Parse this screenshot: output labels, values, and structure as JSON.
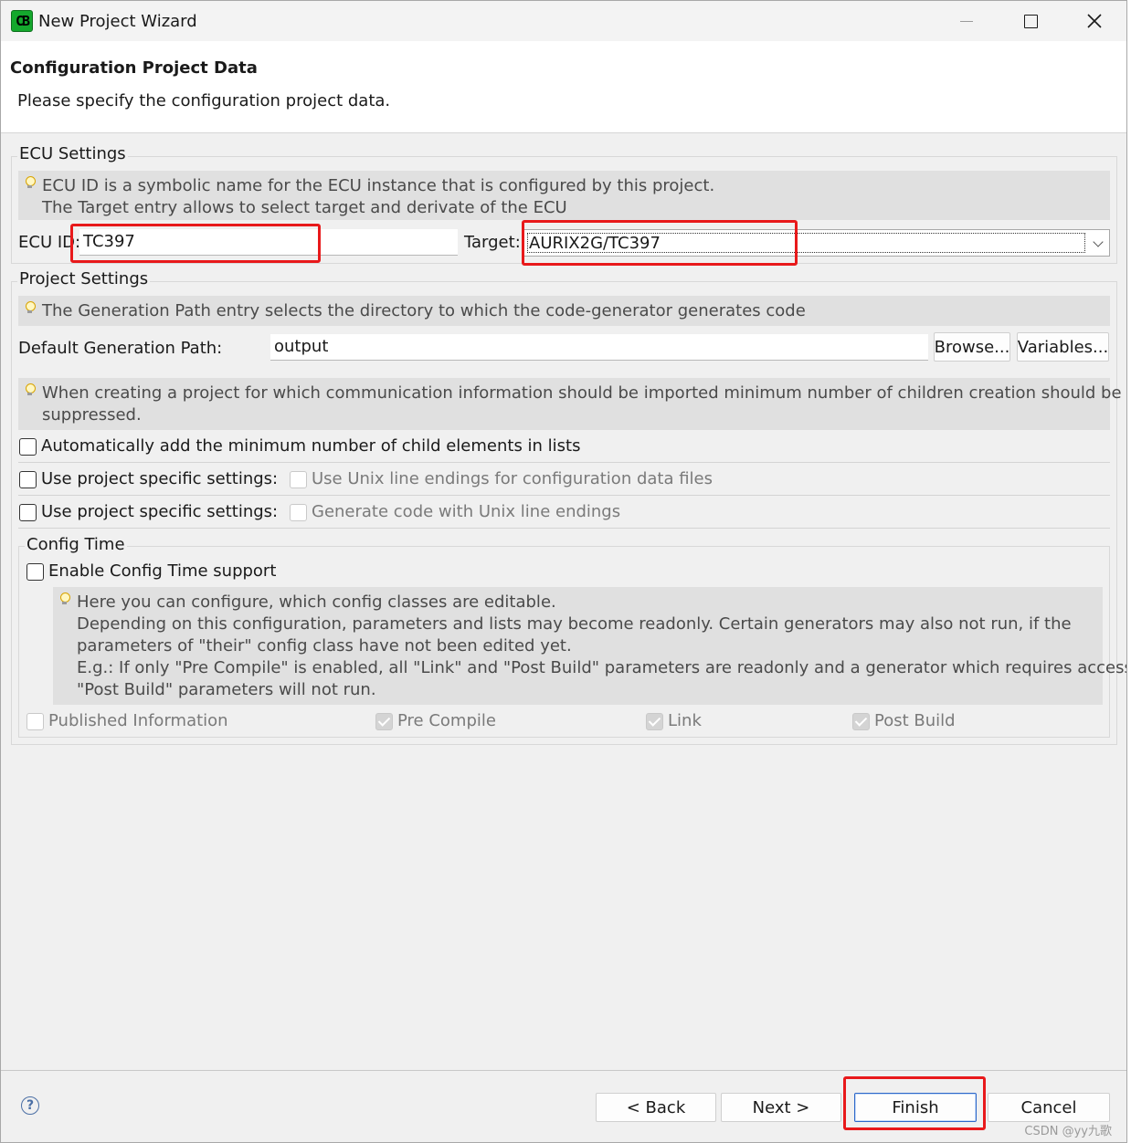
{
  "window": {
    "title": "New Project Wizard",
    "app_icon_text": "CB"
  },
  "header": {
    "title": "Configuration Project Data",
    "description": "Please specify the configuration project data."
  },
  "ecu_settings": {
    "group_label": "ECU Settings",
    "info_line1": "ECU ID is a symbolic name for the ECU instance that is configured by this project.",
    "info_line2": "The Target entry allows to select target and derivate of the ECU",
    "ecu_id_label": "ECU ID:",
    "ecu_id_value": "TC397",
    "target_label": "Target:",
    "target_value": "AURIX2G/TC397"
  },
  "project_settings": {
    "group_label": "Project Settings",
    "info": "The Generation Path entry selects the directory to which the code-generator generates code",
    "path_label": "Default Generation Path:",
    "path_value": "output",
    "browse_label": "Browse...",
    "variables_label": "Variables...",
    "info2_line1": "When creating a project for which communication information should be imported minimum number of children creation should be",
    "info2_line2": "suppressed.",
    "auto_add_label": "Automatically add the minimum number of child elements in lists",
    "specific1_label": "Use project specific settings:",
    "unix_config_label": "Use Unix line endings for configuration data files",
    "specific2_label": "Use project specific settings:",
    "unix_code_label": "Generate code with Unix line endings"
  },
  "config_time": {
    "group_label": "Config Time",
    "enable_label": "Enable Config Time support",
    "info_line1": "Here you can configure, which config classes are editable.",
    "info_line2": "Depending on this configuration, parameters and lists may become readonly. Certain generators may also not run, if the",
    "info_line3": "parameters of \"their\" config class have not been edited yet.",
    "info_line4": "E.g.: If only \"Pre Compile\" is enabled, all \"Link\" and \"Post Build\" parameters are readonly and a generator which requires access to",
    "info_line5": "\"Post Build\" parameters will not run.",
    "published_label": "Published Information",
    "pre_compile_label": "Pre Compile",
    "link_label": "Link",
    "post_build_label": "Post Build"
  },
  "footer": {
    "back_label": "< Back",
    "next_label": "Next >",
    "finish_label": "Finish",
    "cancel_label": "Cancel",
    "help_glyph": "?"
  },
  "watermark": "CSDN @yy九歌",
  "colors": {
    "highlight": "#e8191b",
    "default_button_border": "#2d68c9",
    "info_bg": "#e0e0e0",
    "dialog_bg": "#f0f0f0"
  }
}
